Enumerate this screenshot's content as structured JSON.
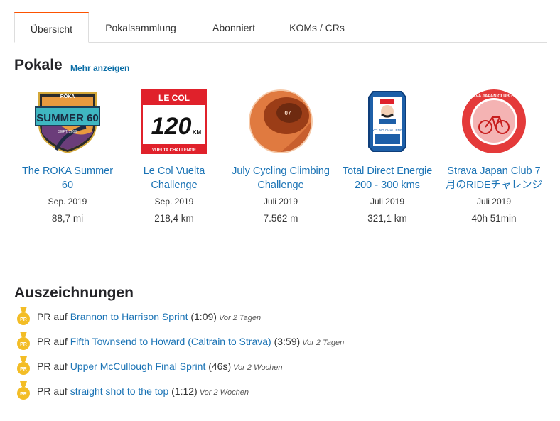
{
  "tabs": [
    "Übersicht",
    "Pokalsammlung",
    "Abonniert",
    "KOMs / CRs"
  ],
  "trophies_section": {
    "title": "Pokale",
    "more_link": "Mehr anzeigen"
  },
  "trophies": [
    {
      "name": "The ROKA Summer 60",
      "date": "Sep. 2019",
      "value": "88,7 mi",
      "badge": {
        "top": "RŌKA",
        "main": "SUMMER 60",
        "sub": "SEPT. 2019"
      }
    },
    {
      "name": "Le Col Vuelta Challenge",
      "date": "Sep. 2019",
      "value": "218,4 km",
      "badge": {
        "top": "LE COL",
        "main": "120",
        "unit": "KM",
        "sub": "VUELTA CHALLENGE"
      }
    },
    {
      "name": "July Cycling Climbing Challenge",
      "date": "Juli 2019",
      "value": "7.562 m",
      "badge": {
        "main": "07"
      }
    },
    {
      "name": "Total Direct Energie 200 - 300 kms",
      "date": "Juli 2019",
      "value": "321,1 km",
      "badge": {
        "sub": "CYCLING CHALLENGE"
      }
    },
    {
      "name": "Strava Japan Club 7月のRIDEチャレンジ",
      "date": "Juli 2019",
      "value": "40h 51min",
      "badge": {
        "ring": "STRAVA JAPAN CLUB · RIDE"
      }
    }
  ],
  "awards_section": {
    "title": "Auszeichnungen"
  },
  "awards": [
    {
      "prefix": "PR auf",
      "segment": "Brannon to Harrison Sprint",
      "time": "(1:09)",
      "ago": "Vor 2 Tagen"
    },
    {
      "prefix": "PR auf",
      "segment": "Fifth Townsend to Howard (Caltrain to Strava)",
      "time": "(3:59)",
      "ago": "Vor 2 Tagen"
    },
    {
      "prefix": "PR auf",
      "segment": "Upper McCullough Final Sprint",
      "time": "(46s)",
      "ago": "Vor 2 Wochen"
    },
    {
      "prefix": "PR auf",
      "segment": "straight shot to the top",
      "time": "(1:12)",
      "ago": "Vor 2 Wochen"
    }
  ],
  "medal_label": "PR",
  "colors": {
    "accent": "#fc5200",
    "link": "#1a73b5",
    "medal": "#f3bd26"
  }
}
